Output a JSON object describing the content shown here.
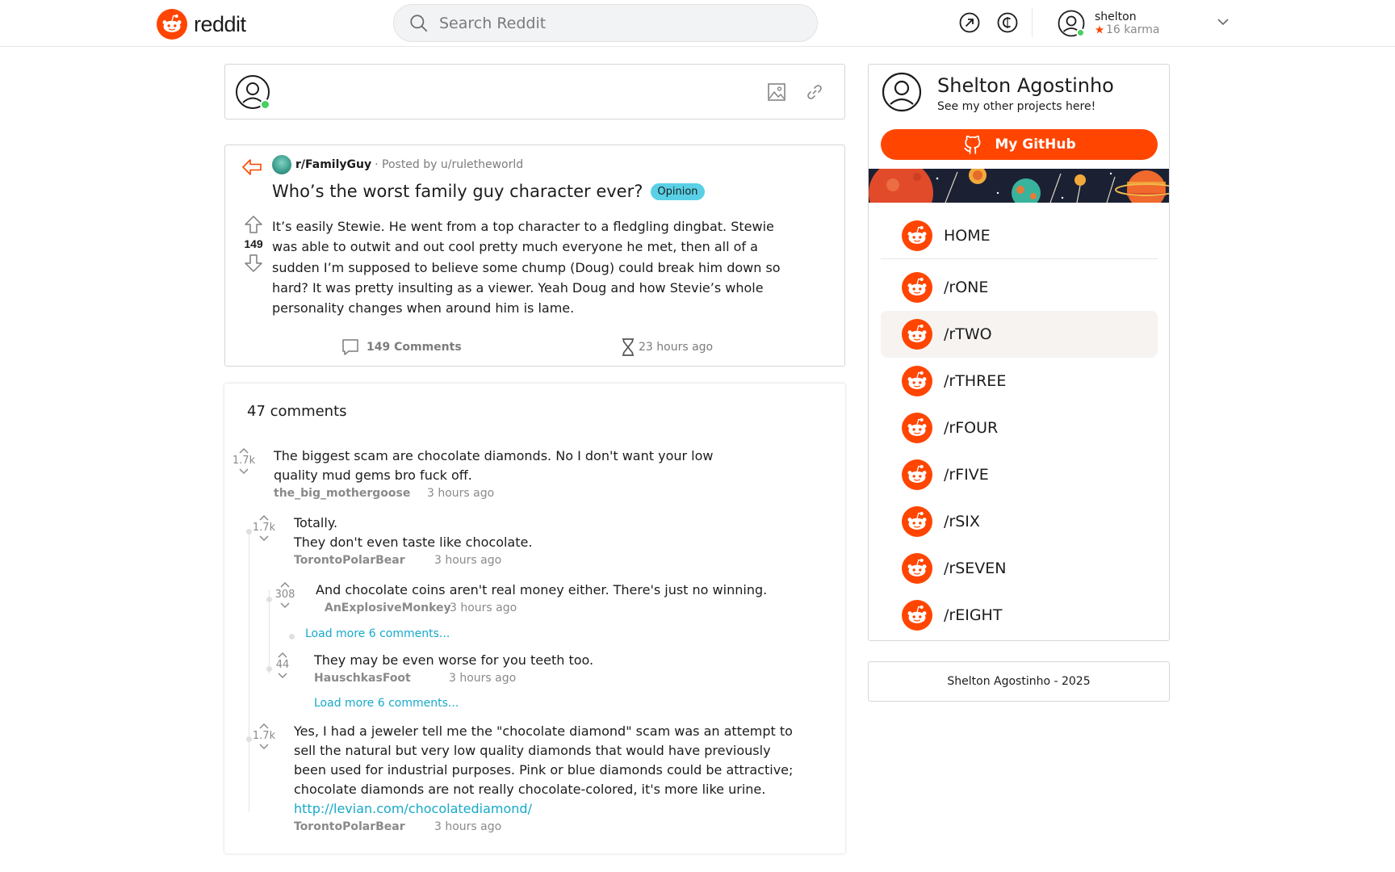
{
  "header": {
    "logo_text": "reddit",
    "search_placeholder": "Search Reddit",
    "user": {
      "name": "shelton",
      "karma": "16 karma"
    },
    "icons": [
      "popular-icon",
      "coins-icon",
      "chevron-down-icon"
    ]
  },
  "post": {
    "subreddit": "r/FamilyGuy",
    "posted_by": "· Posted by u/ruletheworld",
    "title": "Who’s the worst family guy character ever?",
    "flair": "Opinion",
    "votes": "149",
    "body": "It’s easily Stewie. He went from a top character to a fledgling dingbat. Stewie was able to outwit and out cool pretty much everyone he met, then all of a sudden I’m supposed to believe some chump (Doug) could break him down so hard? It was pretty insulting as a viewer. Yeah Doug and how Stevie’s whole personality changes when around him is lame.",
    "comments_label": "149 Comments",
    "time": "23 hours ago"
  },
  "comments": {
    "count_label": "47 comments",
    "items": [
      {
        "votes": "1.7k",
        "text": "The biggest scam are chocolate diamonds. No I don't want your low quality mud gems bro fuck off.",
        "author": "the_big_mothergoose",
        "time": "3 hours ago"
      },
      {
        "votes": "1.7k",
        "text": "Totally.\nThey don't even taste like chocolate.",
        "author": "TorontoPolarBear",
        "time": "3 hours ago"
      },
      {
        "votes": "308",
        "text": "And chocolate coins aren't real money either. There's just no winning.",
        "author": "AnExplosiveMonkey",
        "time": "3 hours ago"
      },
      {
        "votes": "44",
        "text": "They may be even worse for you teeth too.",
        "author": "HauschkasFoot",
        "time": "3 hours ago"
      },
      {
        "votes": "1.7k",
        "text": "Yes, I had a jeweler tell me the \"chocolate diamond\" scam was an attempt to sell the natural but very low quality diamonds that would have previously been used for industrial purposes. Pink or blue diamonds could be attractive; chocolate diamonds are not really chocolate-colored, it's more like urine.",
        "link": "http://levian.com/chocolatediamond/",
        "author": "TorontoPolarBear",
        "time": "3 hours ago"
      }
    ],
    "load_more": [
      "Load more 6 comments...",
      "Load more 6 comments..."
    ]
  },
  "sidebar": {
    "profile_name": "Shelton Agostinho",
    "profile_sub": "See my other projects here!",
    "github_label": "My GitHub",
    "nav": [
      "HOME",
      "/rONE",
      "/rTWO",
      "/rTHREE",
      "/rFOUR",
      "/rFIVE",
      "/rSIX",
      "/rSEVEN",
      "/rEIGHT"
    ],
    "active_nav": "/rTWO",
    "footer": "Shelton Agostinho - 2025"
  },
  "colors": {
    "accent": "#ff4500",
    "link": "#17a9c9",
    "flair": "#59d0e6",
    "online": "#46d160"
  }
}
